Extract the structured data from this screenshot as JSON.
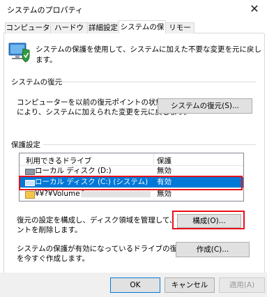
{
  "window": {
    "title": "システムのプロパティ",
    "close": "✕"
  },
  "tabs": [
    {
      "label": "コンピューター名"
    },
    {
      "label": "ハードウェア"
    },
    {
      "label": "詳細設定"
    },
    {
      "label": "システムの保護"
    },
    {
      "label": "リモート"
    }
  ],
  "intro": {
    "text": "システムの保護を使用して、システムに加えた不要な変更を元に戻します。"
  },
  "restore": {
    "heading": "システムの復元",
    "desc_line1": "コンピューターを以前の復元ポイントの状態に戻すこと",
    "desc_line2": "により、システムに加えられた変更を元に戻します。",
    "button": "システムの復元(S)..."
  },
  "protection": {
    "heading": "保護設定",
    "col_drive": "利用できるドライブ",
    "col_protect": "保護",
    "drives": [
      {
        "name": "ローカル ディスク (D:)",
        "status": "無効"
      },
      {
        "name": "ローカル ディスク (C:) (システム)",
        "status": "有効"
      },
      {
        "name": "¥¥?¥Volume{",
        "status": "無効"
      }
    ],
    "configure_line1": "復元の設定を構成し、ディスク領域を管理して、復元ポイ",
    "configure_line2": "ントを削除します。",
    "configure_button": "構成(O)...",
    "create_line1": "システムの保護が有効になっているドライブの復元ポイント",
    "create_line2": "を今すぐ作成します。",
    "create_button": "作成(C)..."
  },
  "footer": {
    "ok": "OK",
    "cancel": "キャンセル",
    "apply": "適用(A)"
  },
  "colors": {
    "accent": "#0078d7",
    "highlight": "#e8101a"
  }
}
